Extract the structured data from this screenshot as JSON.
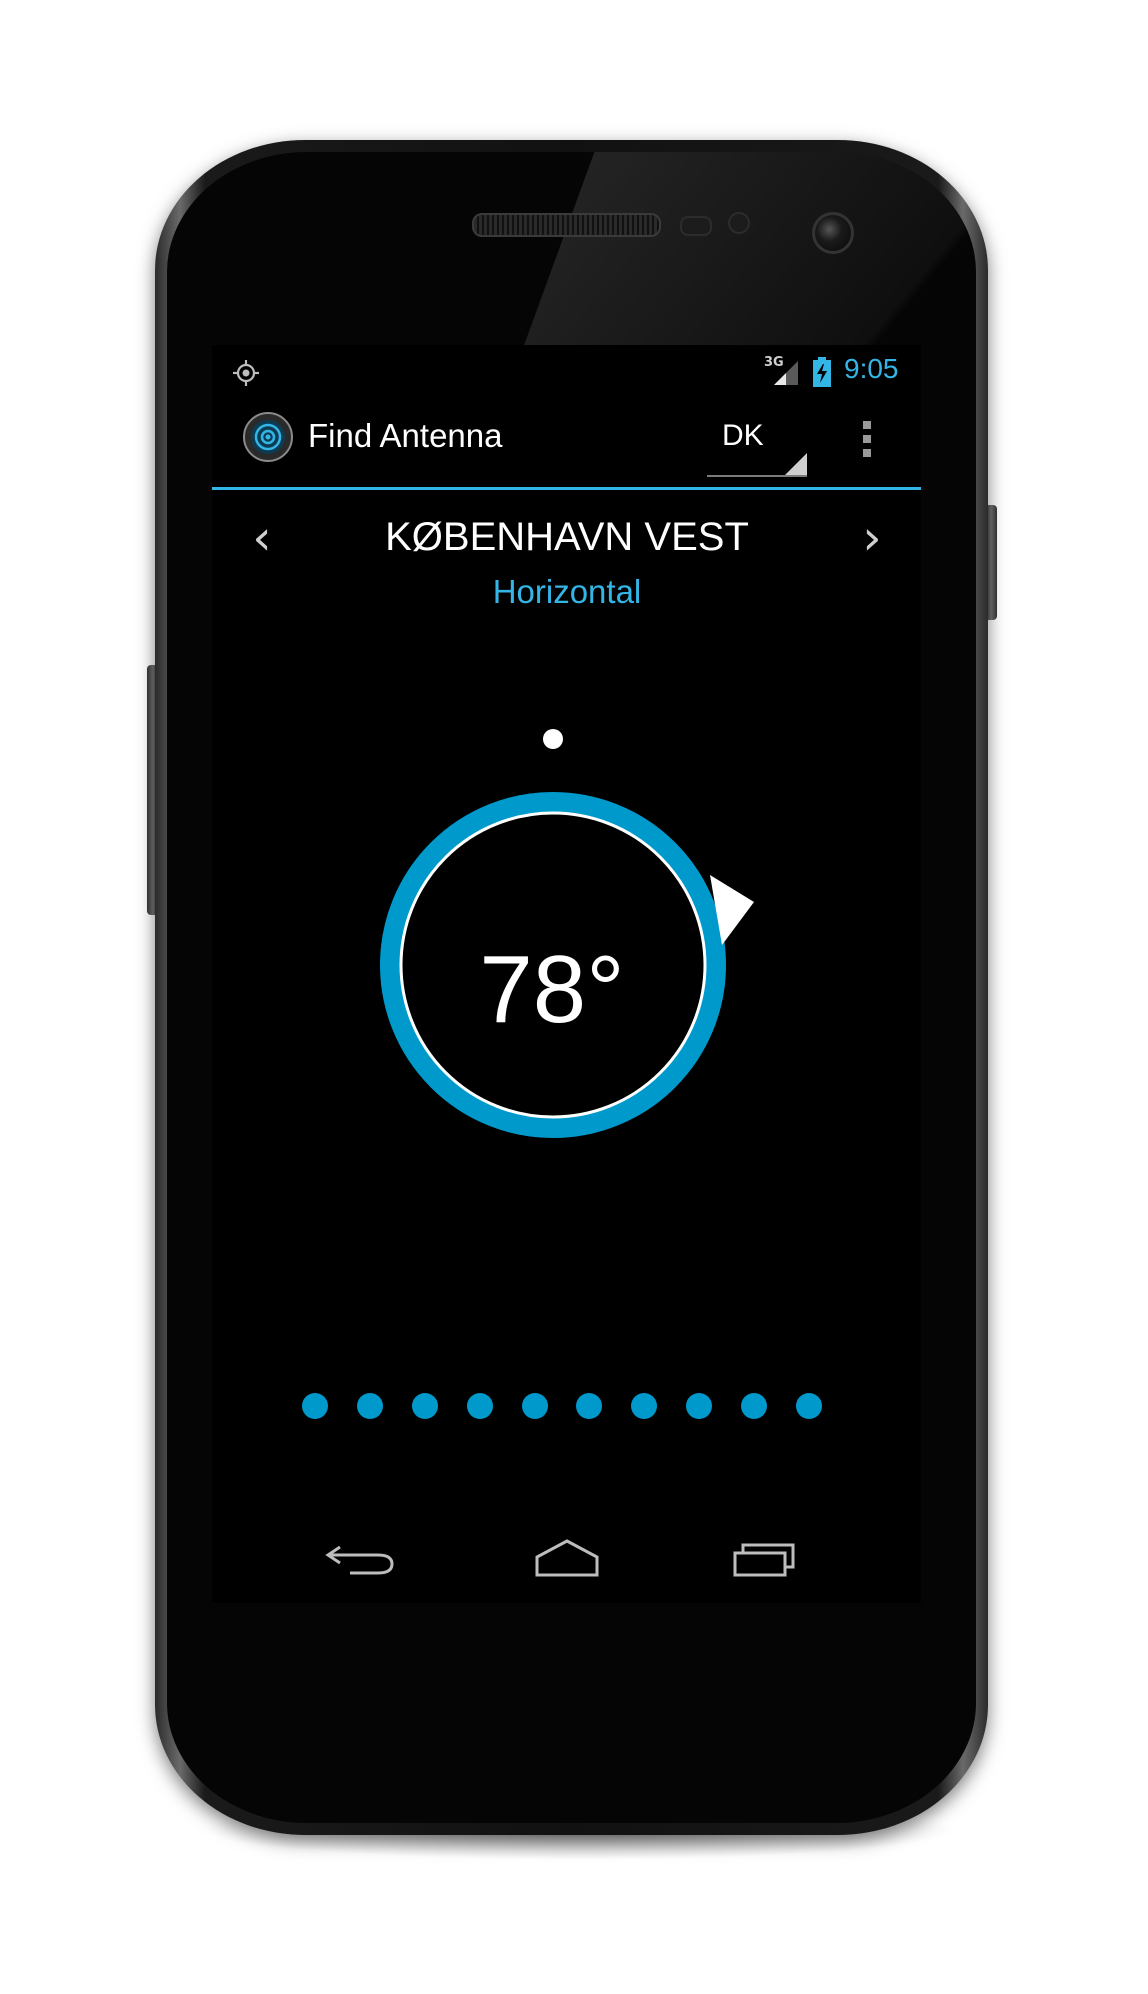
{
  "status_bar": {
    "network_type": "3G",
    "time": "9:05",
    "icons": [
      "gps-icon",
      "signal-icon",
      "battery-charging-icon"
    ]
  },
  "action_bar": {
    "app_icon": "antenna-app-icon",
    "title": "Find Antenna",
    "country_spinner_value": "DK",
    "overflow_icon": "overflow-menu-icon"
  },
  "station": {
    "name": "KØBENHAVN VEST",
    "polarization": "Horizontal",
    "prev_icon": "chevron-left-icon",
    "next_icon": "chevron-right-icon"
  },
  "compass": {
    "angle": "78°",
    "ring_color": "#33b5e5",
    "accent_color": "#0099cc"
  },
  "pager": {
    "page_count": 10
  },
  "nav_bar": {
    "icons": [
      "back-icon",
      "home-icon",
      "recent-apps-icon"
    ]
  }
}
